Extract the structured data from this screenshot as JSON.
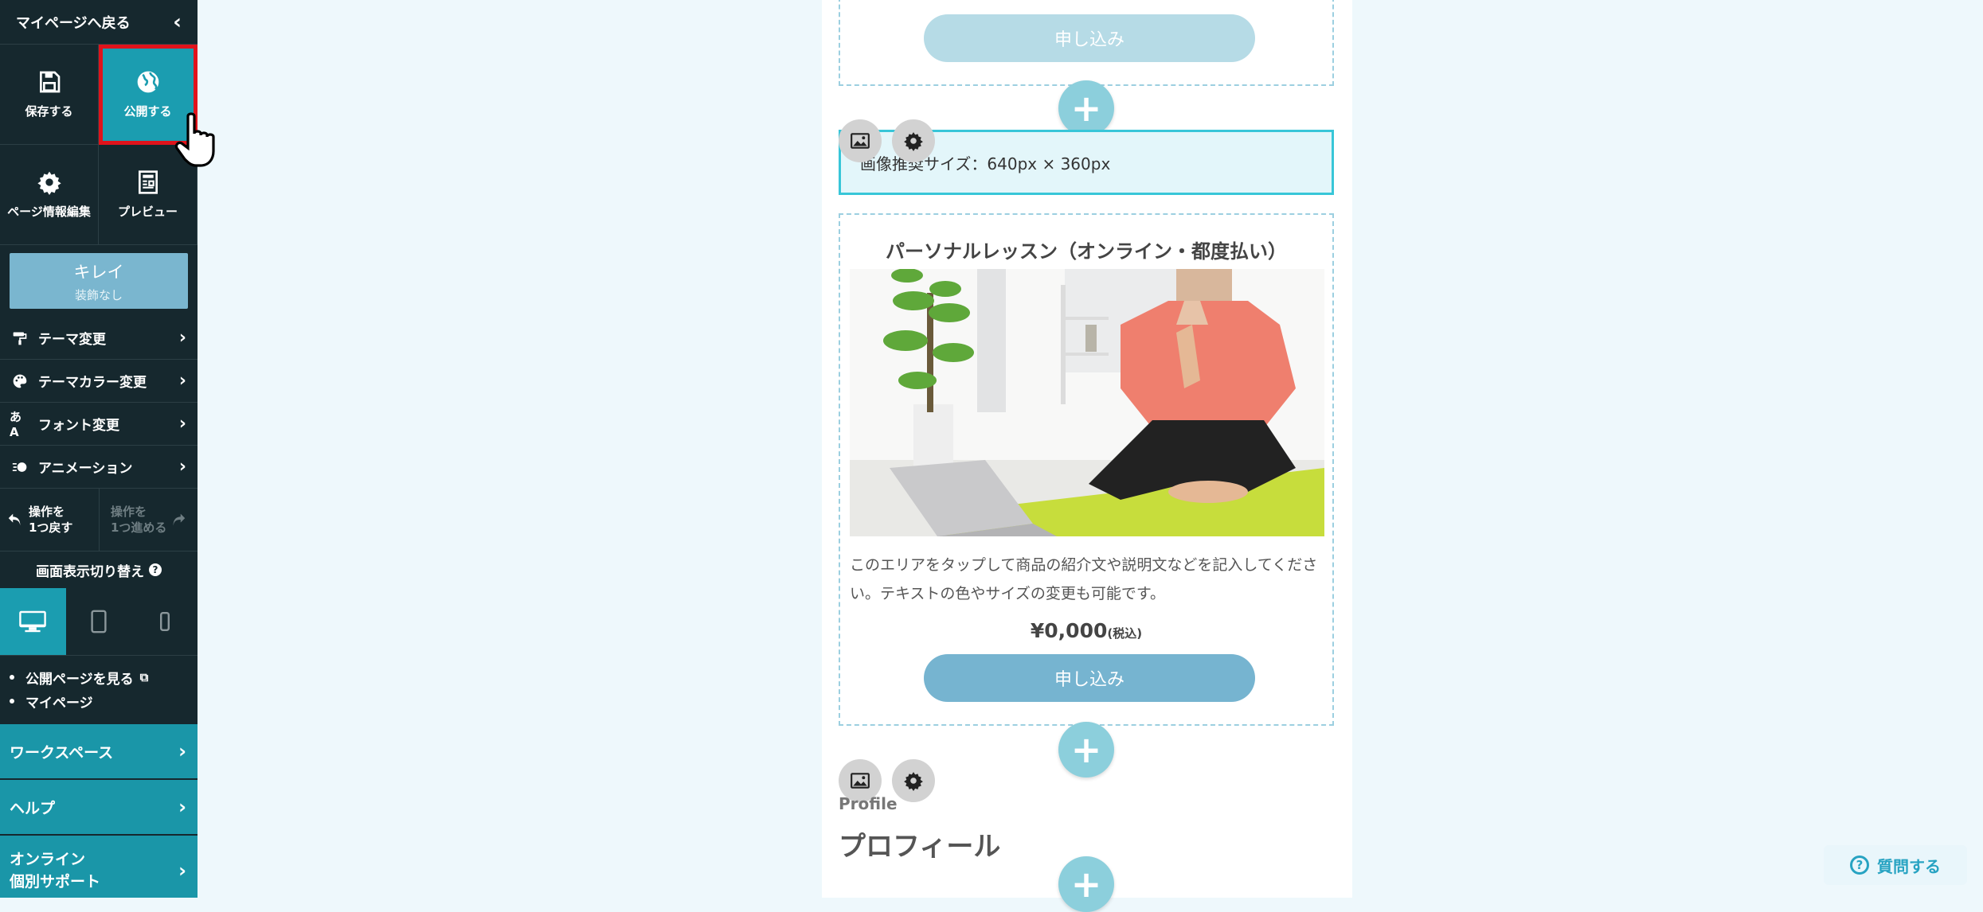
{
  "sidebar": {
    "back_label": "マイページへ戻る",
    "save_label": "保存する",
    "publish_label": "公開する",
    "page_info_label": "ページ情報編集",
    "preview_label": "プレビュー",
    "style_name": "キレイ",
    "style_sub": "装飾なし",
    "menu": [
      {
        "label": "テーマ変更"
      },
      {
        "label": "テーマカラー変更"
      },
      {
        "label": "フォント変更"
      },
      {
        "label": "アニメーション"
      }
    ],
    "undo_label": "操作を\n1つ戻す",
    "redo_label": "操作を\n1つ進める",
    "view_switch_label": "画面表示切り替え",
    "links": [
      "公開ページを見る",
      "マイページ"
    ],
    "workspace_label": "ワークスペース",
    "help_label": "ヘルプ",
    "support_line1": "オンライン",
    "support_line2": "個別サポート"
  },
  "canvas": {
    "apply_label": "申し込み",
    "image_size_note": "画像推奨サイズ：640px × 360px",
    "product": {
      "title": "パーソナルレッスン（オンライン・都度払い）",
      "description": "このエリアをタップして商品の紹介文や説明文などを記入してください。テキストの色やサイズの変更も可能です。",
      "price": "¥0,000",
      "tax": "(税込)"
    },
    "profile_en": "Profile",
    "profile_jp": "プロフィール"
  },
  "ask_label": "質問する",
  "colors": {
    "sidebar_bg": "#16282e",
    "accent_teal": "#1b9db0",
    "button_blue": "#76b4d0",
    "highlight_red": "#e0131b"
  }
}
